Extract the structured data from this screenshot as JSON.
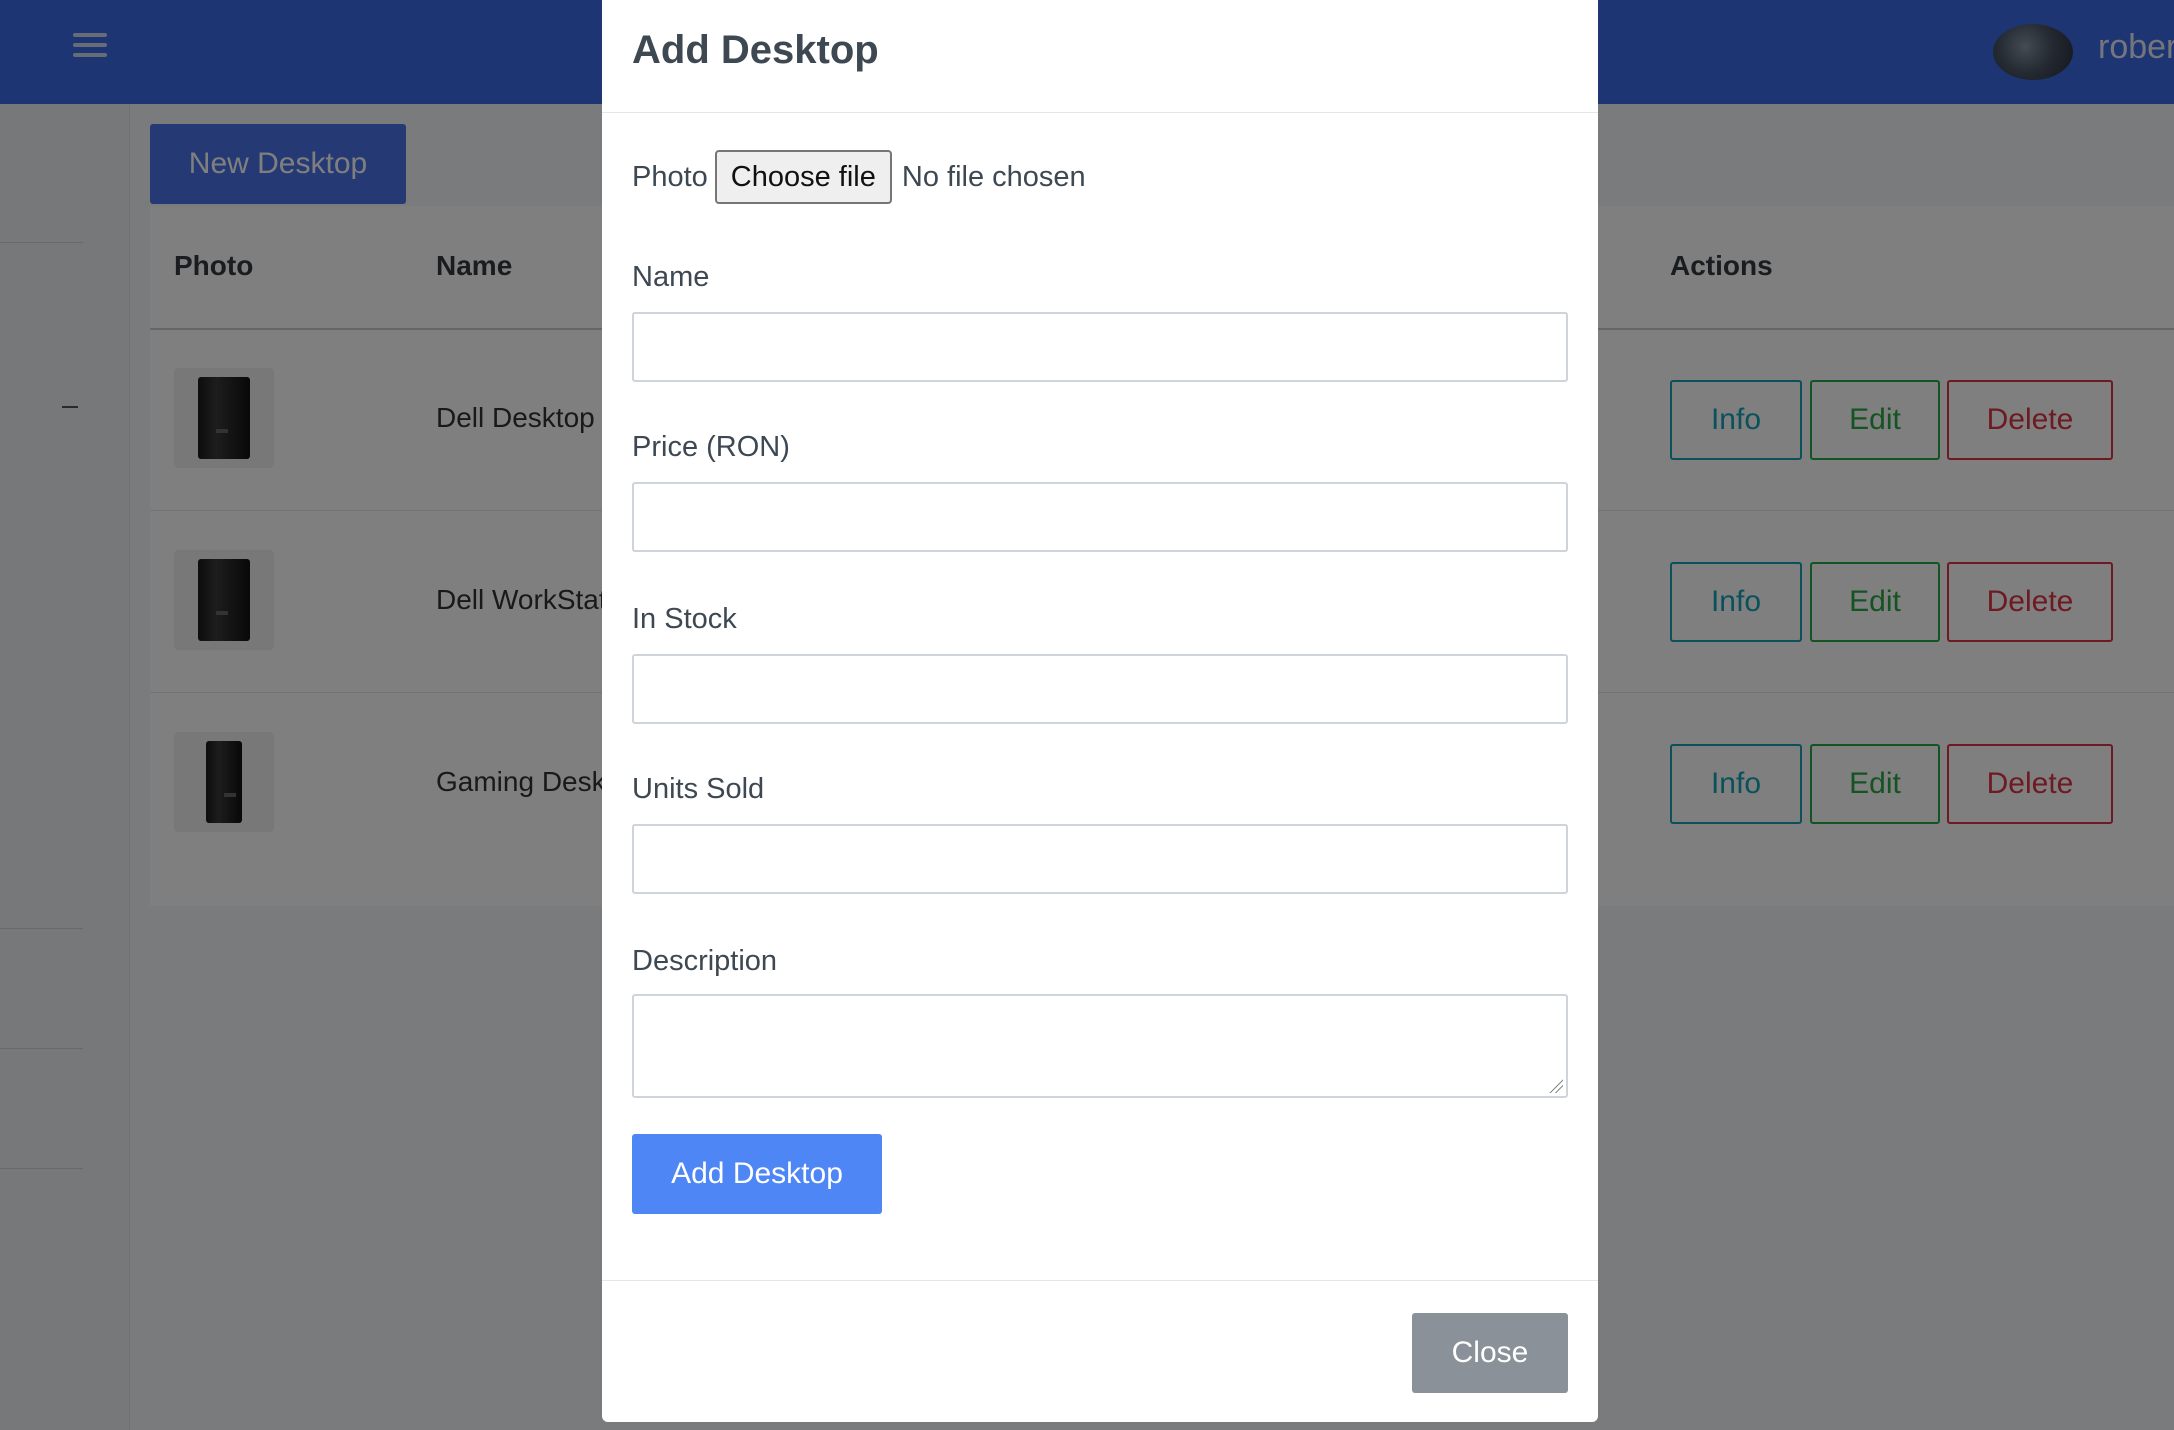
{
  "navbar": {
    "menu_icon": "hamburger-icon",
    "username": "rober"
  },
  "toolbar": {
    "new_button": "New Desktop"
  },
  "table": {
    "headers": [
      "Photo",
      "Name",
      "Actions"
    ],
    "rows": [
      {
        "name": "Dell Desktop",
        "photo_icon": "desktop-tower-icon"
      },
      {
        "name": "Dell WorkStat",
        "photo_icon": "desktop-tower-icon"
      },
      {
        "name": "Gaming Desk",
        "photo_icon": "desktop-tower-icon"
      }
    ],
    "actions": {
      "info": "Info",
      "edit": "Edit",
      "delete": "Delete"
    }
  },
  "modal": {
    "title": "Add Desktop",
    "photo_label": "Photo",
    "file_button": "Choose file",
    "file_status": "No file chosen",
    "fields": {
      "name": {
        "label": "Name",
        "value": ""
      },
      "price": {
        "label": "Price (RON)",
        "value": ""
      },
      "in_stock": {
        "label": "In Stock",
        "value": ""
      },
      "units_sold": {
        "label": "Units Sold",
        "value": ""
      },
      "description": {
        "label": "Description",
        "value": ""
      }
    },
    "submit_button": "Add Desktop",
    "close_button": "Close"
  },
  "colors": {
    "navbar": "#3c6ae6",
    "primary": "#4f86f6",
    "info": "#17a2b8",
    "success": "#28a745",
    "danger": "#dc3545",
    "secondary": "#8a9199"
  }
}
